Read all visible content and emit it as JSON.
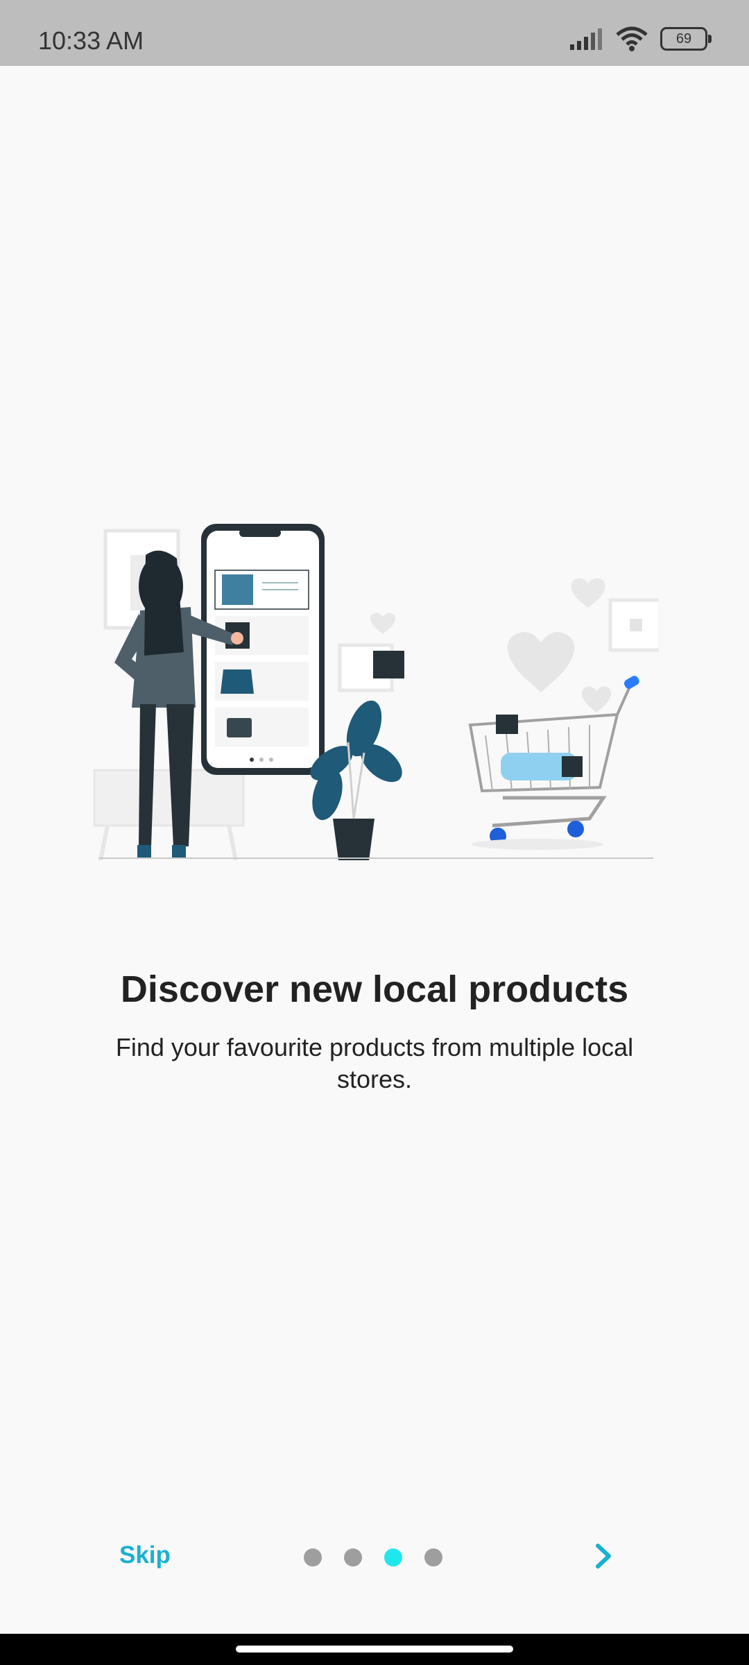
{
  "status_bar": {
    "time": "10:33 AM",
    "battery": "69",
    "icons": [
      "signal-icon",
      "wifi-icon",
      "battery-icon"
    ]
  },
  "onboarding": {
    "title": "Discover new local products",
    "subtitle": "Find your favourite products from multiple local stores.",
    "illustration": "woman-shopping-on-phone-with-cart-illustration"
  },
  "footer": {
    "skip_label": "Skip",
    "page_count": 4,
    "active_page": 3,
    "next_icon": "chevron-right-icon"
  },
  "colors": {
    "accent": "#1ab0cf",
    "active_dot": "#20e7ec",
    "inactive_dot": "#9e9e9e"
  }
}
